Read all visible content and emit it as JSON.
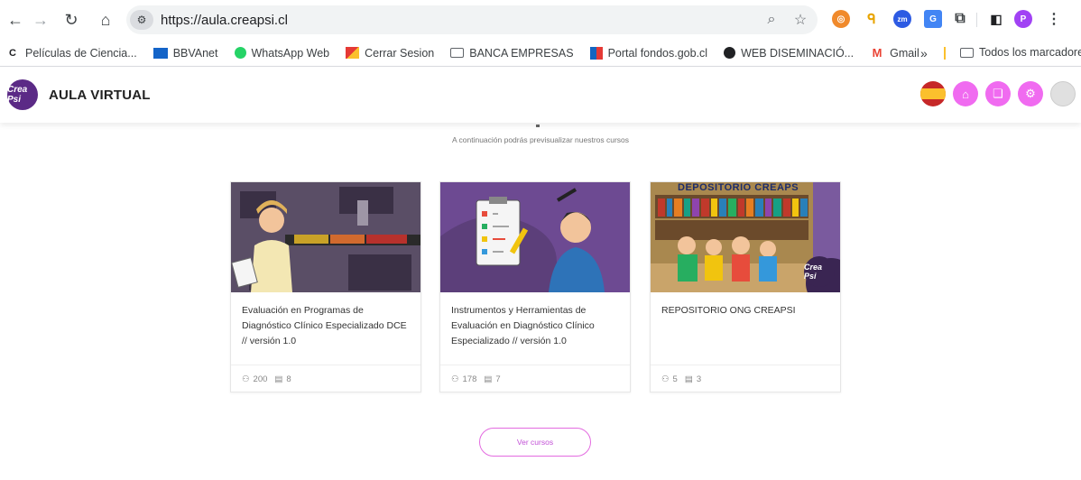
{
  "browser": {
    "url": "https://aula.creapsi.cl",
    "bookmarks": [
      {
        "label": "Películas de Ciencia...",
        "icon": "c-icon",
        "color": "#202124"
      },
      {
        "label": "BBVAnet",
        "icon": "bbva-icon",
        "color": "#1464c8"
      },
      {
        "label": "WhatsApp Web",
        "icon": "whatsapp-icon",
        "color": "#25d366"
      },
      {
        "label": "Cerrar Sesion",
        "icon": "flag-icon",
        "color": "#e53935"
      },
      {
        "label": "BANCA EMPRESAS",
        "icon": "folder-icon",
        "color": "#5f6368"
      },
      {
        "label": "Portal fondos.gob.cl",
        "icon": "fondos-icon",
        "color": "#1565c0"
      },
      {
        "label": "WEB DISEMINACIÓ...",
        "icon": "globe-icon",
        "color": "#202124"
      },
      {
        "label": "Gmail",
        "icon": "gmail-icon",
        "color": "#ea4335"
      }
    ],
    "overflow_label": "»",
    "all_bookmarks_label": "Todos los marcadores",
    "profile_initial": "P"
  },
  "site": {
    "title": "AULA VIRTUAL",
    "logo_text": "Crea Psi",
    "accent": "#f06bf0"
  },
  "main": {
    "subtitle": "A continuación podrás previsualizar nuestros cursos",
    "courses": [
      {
        "title": "Evaluación en Programas de Diagnóstico Clínico Especializado DCE // versión 1.0",
        "students": "200",
        "lessons": "8"
      },
      {
        "title": "Instrumentos y Herramientas de Evaluación en Diagnóstico Clínico Especializado // versión 1.0",
        "students": "178",
        "lessons": "7"
      },
      {
        "title": "REPOSITORIO ONG CREAPSI",
        "students": "5",
        "lessons": "3",
        "banner": "DEPOSITORIO CREAPS"
      }
    ],
    "more_button": "Ver cursos"
  }
}
